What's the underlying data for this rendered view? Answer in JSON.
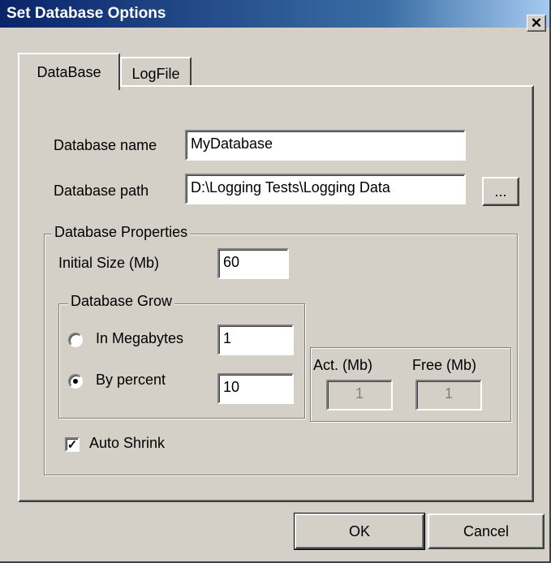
{
  "window": {
    "title": "Set Database Options",
    "close_glyph": "✕"
  },
  "tabs": [
    {
      "label": "DataBase",
      "active": true
    },
    {
      "label": "LogFile",
      "active": false
    }
  ],
  "database": {
    "name_label": "Database name",
    "name_value": "MyDatabase",
    "path_label": "Database path",
    "path_value": "D:\\Logging Tests\\Logging Data",
    "browse_label": "..."
  },
  "properties": {
    "group_label": "Database Properties",
    "initial_size_label": "Initial Size (Mb)",
    "initial_size_value": "60",
    "grow": {
      "group_label": "Database Grow",
      "megabytes_label": "In Megabytes",
      "megabytes_value": "1",
      "megabytes_selected": false,
      "percent_label": "By percent",
      "percent_value": "10",
      "percent_selected": true
    },
    "usage": {
      "actual_label": "Act. (Mb)",
      "actual_value": "1",
      "free_label": "Free (Mb)",
      "free_value": "1"
    },
    "auto_shrink_label": "Auto Shrink",
    "auto_shrink_checked": true,
    "check_glyph": "✓"
  },
  "buttons": {
    "ok": "OK",
    "cancel": "Cancel"
  }
}
